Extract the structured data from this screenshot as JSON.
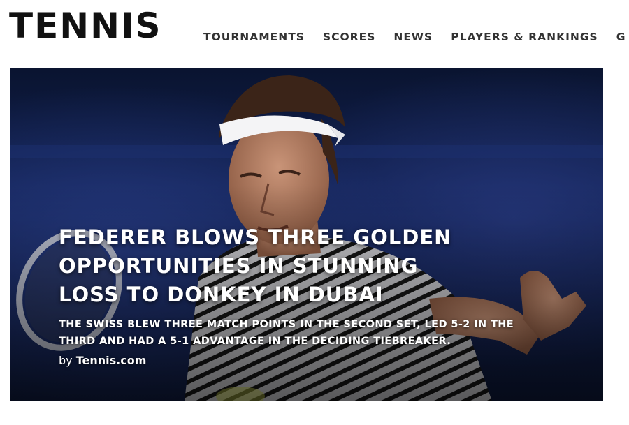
{
  "header": {
    "logo_text": "TENNIS",
    "nav": [
      {
        "label": "TOURNAMENTS"
      },
      {
        "label": "SCORES"
      },
      {
        "label": "NEWS"
      },
      {
        "label": "PLAYERS & RANKINGS"
      },
      {
        "label": "G"
      }
    ]
  },
  "hero": {
    "headline": "FEDERER BLOWS THREE GOLDEN OPPORTUNITIES IN STUNNING LOSS TO DONKEY IN DUBAI",
    "dek": "THE SWISS BLEW THREE MATCH POINTS IN THE SECOND SET, LED 5-2 IN THE THIRD AND HAD A 5-1 ADVANTAGE IN THE DECIDING TIEBREAKER.",
    "byline_prefix": "by",
    "byline_source": "Tennis.com"
  }
}
